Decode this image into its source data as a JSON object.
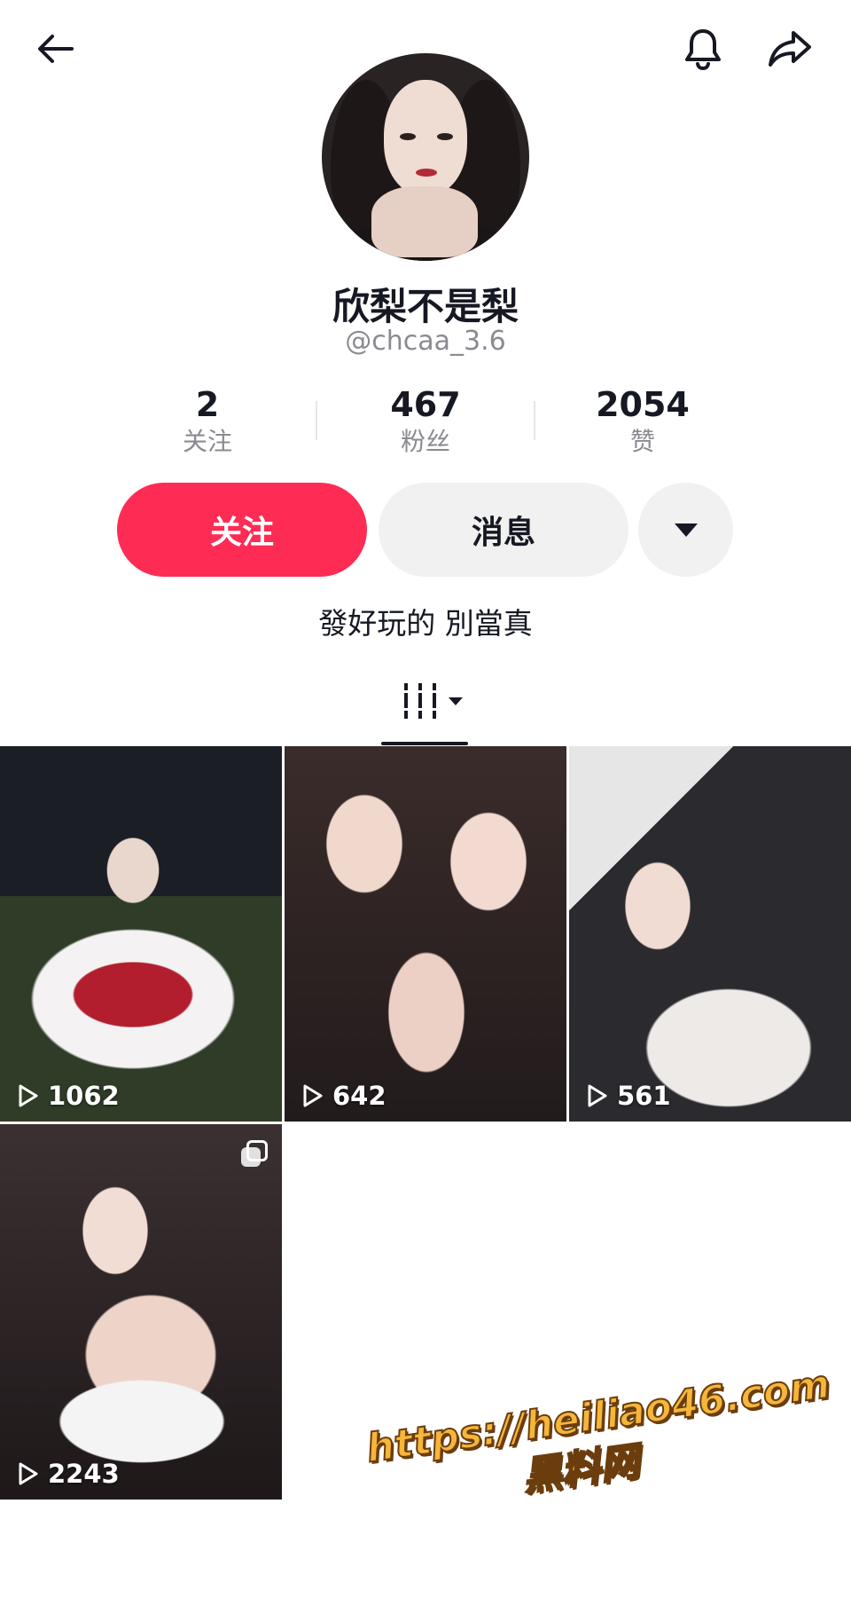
{
  "header": {
    "back_icon": "arrow-left-icon",
    "bell_icon": "bell-icon",
    "share_icon": "share-arrow-icon"
  },
  "profile": {
    "display_name": "欣梨不是梨",
    "handle": "@chcaa_3.6",
    "bio": "發好玩的 別當真"
  },
  "stats": [
    {
      "value": "2",
      "label": "关注"
    },
    {
      "value": "467",
      "label": "粉丝"
    },
    {
      "value": "2054",
      "label": "赞"
    }
  ],
  "actions": {
    "follow_label": "关注",
    "message_label": "消息",
    "more_icon": "dropdown-triangle-icon"
  },
  "tabs": {
    "active_icon": "videos-grid-icon"
  },
  "videos": [
    {
      "views": "1062"
    },
    {
      "views": "642"
    },
    {
      "views": "561"
    },
    {
      "views": "2243",
      "multi": true
    }
  ],
  "watermark": {
    "url": "https://heiliao46.com",
    "text": "黑料网"
  },
  "colors": {
    "accent": "#fe2c55",
    "secondary_button": "#f1f1f2",
    "muted_text": "#8a8b91",
    "primary_text": "#161823"
  }
}
